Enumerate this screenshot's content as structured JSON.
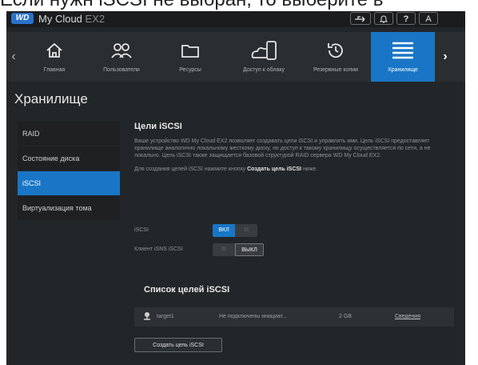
{
  "browser_strip": {
    "text": "Если нужн iSCSI не выбран, то выберите в"
  },
  "header": {
    "logo": "WD",
    "app_name": "My Cloud",
    "model": "EX2",
    "buttons": [
      {
        "icon": "usb-icon",
        "label": "⇆"
      },
      {
        "icon": "bell-icon",
        "label": "🔔"
      },
      {
        "icon": "help-icon",
        "label": "?"
      },
      {
        "icon": "user-icon",
        "label": "A"
      }
    ]
  },
  "nav": {
    "items": [
      {
        "icon": "home-icon",
        "label": "Главная"
      },
      {
        "icon": "users-icon",
        "label": "Пользователи"
      },
      {
        "icon": "folder-icon",
        "label": "Ресурсы"
      },
      {
        "icon": "cloud-devices-icon",
        "label": "Доступ к облаку"
      },
      {
        "icon": "backup-icon",
        "label": "Резервные копии"
      },
      {
        "icon": "storage-icon",
        "label": "Хранилище",
        "active": true
      }
    ]
  },
  "page": {
    "title": "Хранилище"
  },
  "sidebar": {
    "items": [
      {
        "label": "RAID"
      },
      {
        "label": "Состояние диска"
      },
      {
        "label": "iSCSI",
        "active": true
      },
      {
        "label": "Виртуализация тома"
      }
    ]
  },
  "iscsi": {
    "heading": "Цели iSCSI",
    "description": "Ваше устройство WD My Cloud EX2 позволяет создавать цели iSCSI и управлять ими. Цель iSCSI предоставляет хранилище аналогично локальному жесткому диску, но доступ к такому хранилищу осуществляется по сети, а не локально. Цель iSCSI также защищается базовой структурой RAID сервера WD My Cloud EX2.",
    "hint_prefix": "Для создания целей iSCSI нажмите кнопку ",
    "hint_bold": "Создать цель iSCSI",
    "hint_suffix": " ниже.",
    "settings": [
      {
        "label": "iSCSI",
        "on_label": "ВКЛ",
        "off_label": "III",
        "state": "on"
      },
      {
        "label": "Клиент iSNS iSCSI",
        "on_label": "III",
        "off_label": "ВЫКЛ",
        "state": "off"
      }
    ]
  },
  "targets": {
    "heading": "Список целей iSCSI",
    "rows": [
      {
        "icon": "target-icon",
        "name": "target1",
        "status": "Не подключены инициат...",
        "size": "2 GB",
        "link": "Сведения"
      }
    ],
    "create_button": "Создать цель iSCSI"
  },
  "colors": {
    "accent": "#1976c6",
    "background": "#232628"
  }
}
